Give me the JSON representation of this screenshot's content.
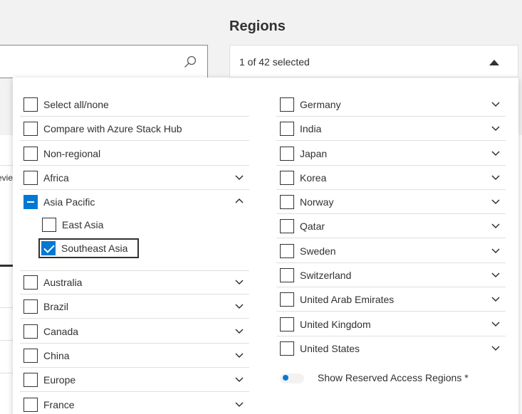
{
  "header": {
    "regions_title": "Regions",
    "search_icon": "search-icon"
  },
  "regions_select": {
    "value": "1 of 42 selected",
    "caret_icon": "caret-up-icon"
  },
  "background": {
    "partial_tab_text": "evie"
  },
  "left_column": [
    {
      "label": "Select all/none",
      "expandable": false,
      "state": "unchecked"
    },
    {
      "label": "Compare with Azure Stack Hub",
      "expandable": false,
      "state": "unchecked"
    },
    {
      "label": "Non-regional",
      "expandable": false,
      "state": "unchecked"
    },
    {
      "label": "Africa",
      "expandable": true,
      "state": "unchecked"
    },
    {
      "label": "Asia Pacific",
      "expandable": true,
      "expanded": true,
      "state": "indeterminate"
    },
    {
      "label": "Australia",
      "expandable": true,
      "state": "unchecked"
    },
    {
      "label": "Brazil",
      "expandable": true,
      "state": "unchecked"
    },
    {
      "label": "Canada",
      "expandable": true,
      "state": "unchecked"
    },
    {
      "label": "China",
      "expandable": true,
      "state": "unchecked"
    },
    {
      "label": "Europe",
      "expandable": true,
      "state": "unchecked"
    },
    {
      "label": "France",
      "expandable": true,
      "state": "unchecked"
    }
  ],
  "asia_pacific_children": [
    {
      "label": "East Asia",
      "state": "unchecked"
    },
    {
      "label": "Southeast Asia",
      "state": "checked"
    }
  ],
  "right_column": [
    {
      "label": "Germany",
      "expandable": true,
      "state": "unchecked"
    },
    {
      "label": "India",
      "expandable": true,
      "state": "unchecked"
    },
    {
      "label": "Japan",
      "expandable": true,
      "state": "unchecked"
    },
    {
      "label": "Korea",
      "expandable": true,
      "state": "unchecked"
    },
    {
      "label": "Norway",
      "expandable": true,
      "state": "unchecked"
    },
    {
      "label": "Qatar",
      "expandable": true,
      "state": "unchecked"
    },
    {
      "label": "Sweden",
      "expandable": true,
      "state": "unchecked"
    },
    {
      "label": "Switzerland",
      "expandable": true,
      "state": "unchecked"
    },
    {
      "label": "United Arab Emirates",
      "expandable": true,
      "state": "unchecked"
    },
    {
      "label": "United Kingdom",
      "expandable": true,
      "state": "unchecked"
    },
    {
      "label": "United States",
      "expandable": true,
      "state": "unchecked"
    }
  ],
  "reserved_toggle": {
    "label": "Show Reserved Access Regions *",
    "on": false
  },
  "colors": {
    "accent": "#0078d4",
    "text": "#323130",
    "divider": "#e1dfdd",
    "page_background": "#f2f2f2"
  }
}
